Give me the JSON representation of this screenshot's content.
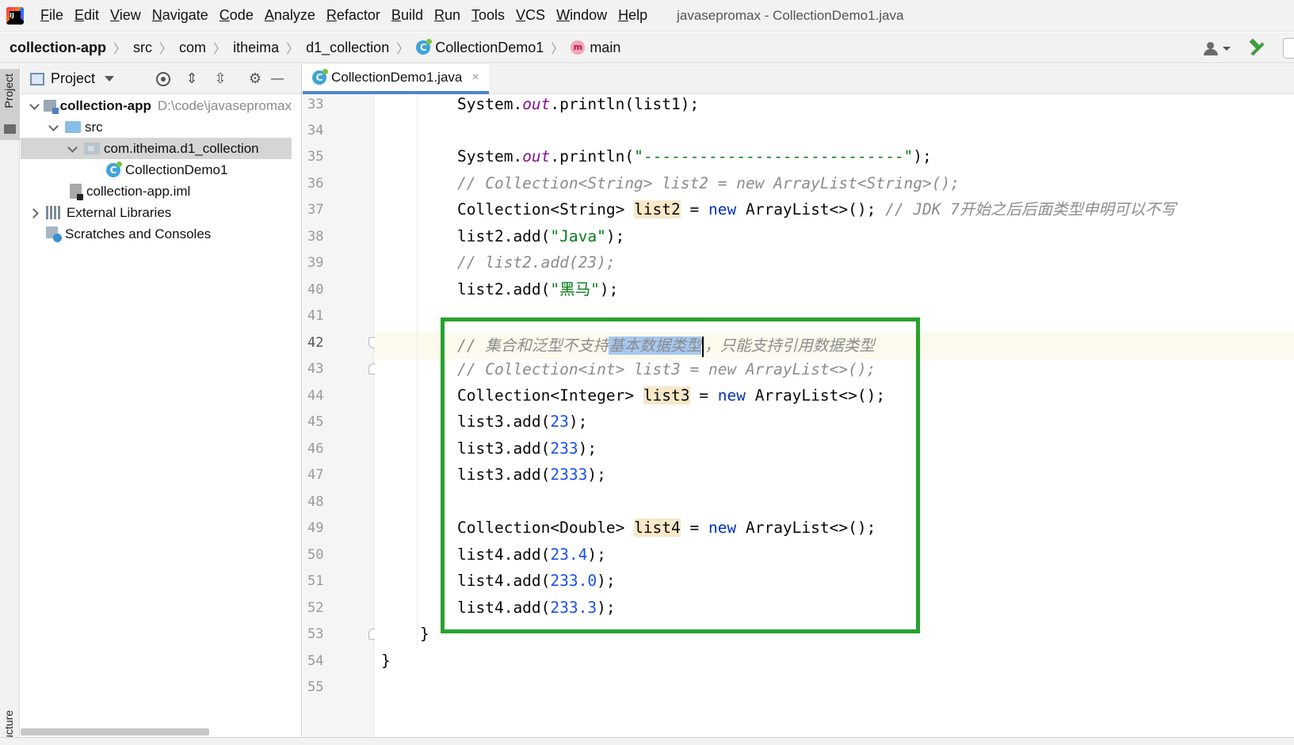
{
  "menubar": {
    "items": [
      "File",
      "Edit",
      "View",
      "Navigate",
      "Code",
      "Analyze",
      "Refactor",
      "Build",
      "Run",
      "Tools",
      "VCS",
      "Window",
      "Help"
    ],
    "window_title": "javasepromax - CollectionDemo1.java"
  },
  "breadcrumb": {
    "project": "collection-app",
    "src": "src",
    "com": "com",
    "itheima": "itheima",
    "package": "d1_collection",
    "class": "CollectionDemo1",
    "class_icon": "C",
    "method": "main",
    "method_icon": "m"
  },
  "tool_strip": {
    "project_label": "Project",
    "structure_label": "ructure"
  },
  "project_panel": {
    "title": "Project",
    "tree": {
      "root_name": "collection-app",
      "root_path": "D:\\code\\javasepromax",
      "src": "src",
      "package": "com.itheima.d1_collection",
      "class": "CollectionDemo1",
      "iml": "collection-app.iml",
      "external_libraries": "External Libraries",
      "scratches": "Scratches and Consoles"
    }
  },
  "editor": {
    "tab_label": "CollectionDemo1.java",
    "tab_close": "×",
    "line_numbers": [
      "33",
      "34",
      "35",
      "36",
      "37",
      "38",
      "39",
      "40",
      "41",
      "42",
      "43",
      "44",
      "45",
      "46",
      "47",
      "48",
      "49",
      "50",
      "51",
      "52",
      "53",
      "54",
      "55"
    ],
    "current_line": "42",
    "code": {
      "l33": {
        "a": "System.",
        "b": "out",
        "c": ".println(list1);"
      },
      "l35": {
        "a": "System.",
        "b": "out",
        "c": ".println(",
        "d": "\"----------------------------\"",
        "e": ");"
      },
      "l36": "// Collection<String> list2 = new ArrayList<String>();",
      "l37": {
        "a": "Collection<String> ",
        "b": "list2",
        "c": " = ",
        "d": "new",
        "e": " ArrayList<>(); ",
        "f": "// JDK 7开始之后后面类型申明可以不写"
      },
      "l38": {
        "a": "list2.add(",
        "b": "\"Java\"",
        "c": ");"
      },
      "l39": "// list2.add(23);",
      "l40": {
        "a": "list2.add(",
        "b": "\"黑马\"",
        "c": ");"
      },
      "l42": {
        "a": "// 集合和泛型不支持",
        "b": "基本数据类型",
        "c": "，只能支持引用数据类型"
      },
      "l43": "// Collection<int> list3 = new ArrayList<>();",
      "l44": {
        "a": "Collection<Integer> ",
        "b": "list3",
        "c": " = ",
        "d": "new",
        "e": " ArrayList<>();"
      },
      "l45": {
        "a": "list3.add(",
        "b": "23",
        "c": ");"
      },
      "l46": {
        "a": "list3.add(",
        "b": "233",
        "c": ");"
      },
      "l47": {
        "a": "list3.add(",
        "b": "2333",
        "c": ");"
      },
      "l49": {
        "a": "Collection<Double> ",
        "b": "list4",
        "c": " = ",
        "d": "new",
        "e": " ArrayList<>();"
      },
      "l50": {
        "a": "list4.add(",
        "b": "23.4",
        "c": ");"
      },
      "l51": {
        "a": "list4.add(",
        "b": "233.0",
        "c": ");"
      },
      "l52": {
        "a": "list4.add(",
        "b": "233.3",
        "c": ");"
      },
      "l53": "}",
      "l54": "}"
    }
  },
  "colors": {
    "annotation_box": "#27a22b",
    "keyword": "#0033b3",
    "string": "#067d17",
    "number": "#1750eb",
    "comment": "#8c8c8c",
    "static_field": "#871094"
  }
}
